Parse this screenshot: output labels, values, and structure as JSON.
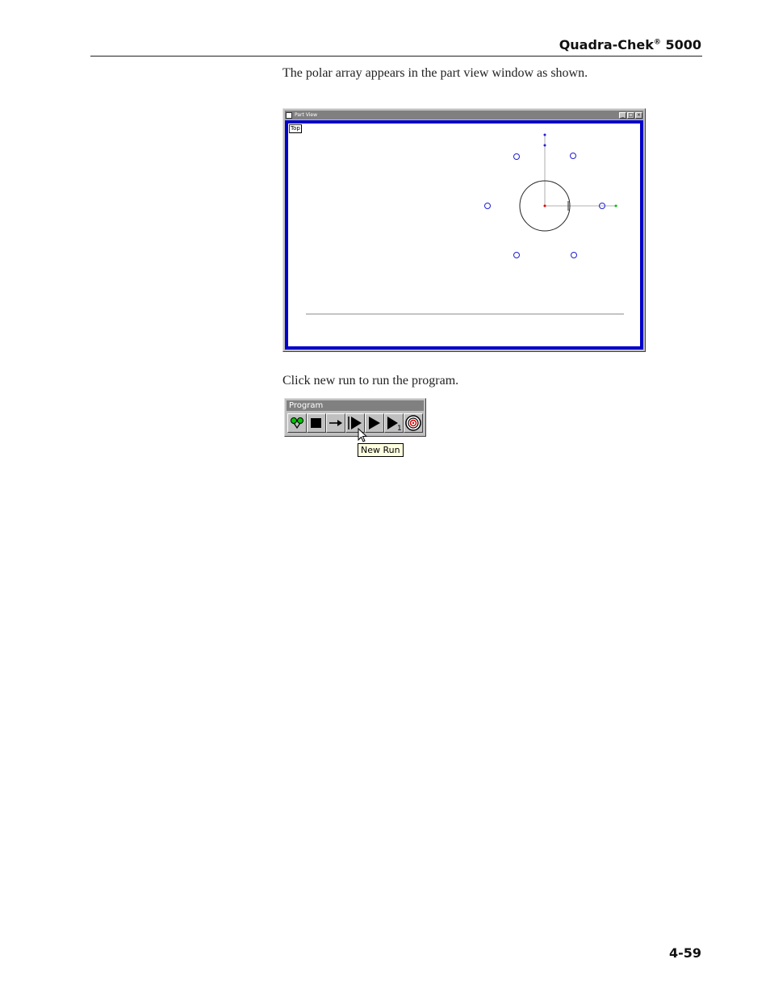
{
  "header": {
    "title": "Quadra-Chek",
    "mark": "®",
    "model": "5000"
  },
  "body": {
    "para1": "The polar array appears in the part view window as shown.",
    "para2": "Click new run to run the program."
  },
  "part_view": {
    "title": "Part View",
    "view_label": "Top",
    "window_buttons": {
      "minimize": "_",
      "maximize": "□",
      "close": "×"
    },
    "colors": {
      "border": "#0000c8",
      "holes": "#2020d0",
      "center": "#e00000",
      "end_point": "#00c000"
    }
  },
  "toolbar": {
    "title": "Program",
    "step_badge": "1",
    "tooltip": "New Run"
  },
  "footer": {
    "page_number": "4-59"
  }
}
